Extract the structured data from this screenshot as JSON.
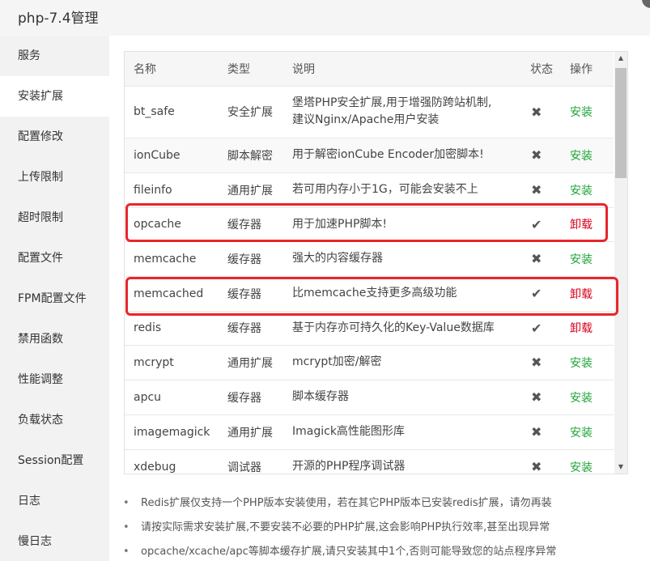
{
  "window": {
    "title": "php-7.4管理"
  },
  "sidebar": {
    "items": [
      {
        "label": "服务"
      },
      {
        "label": "安装扩展"
      },
      {
        "label": "配置修改"
      },
      {
        "label": "上传限制"
      },
      {
        "label": "超时限制"
      },
      {
        "label": "配置文件"
      },
      {
        "label": "FPM配置文件"
      },
      {
        "label": "禁用函数"
      },
      {
        "label": "性能调整"
      },
      {
        "label": "负载状态"
      },
      {
        "label": "Session配置"
      },
      {
        "label": "日志"
      },
      {
        "label": "慢日志"
      }
    ],
    "active_index": 1
  },
  "table": {
    "headers": {
      "name": "名称",
      "type": "类型",
      "desc": "说明",
      "status": "状态",
      "action": "操作"
    },
    "rows": [
      {
        "name": "bt_safe",
        "type": "安全扩展",
        "desc": "堡塔PHP安全扩展,用于增强防跨站机制,",
        "desc2": "建议Nginx/Apache用户安装",
        "status_icon": "✖",
        "installed": false,
        "action": "安装"
      },
      {
        "name": "ionCube",
        "type": "脚本解密",
        "desc": "用于解密ionCube Encoder加密脚本!",
        "status_icon": "✖",
        "installed": false,
        "action": "安装"
      },
      {
        "name": "fileinfo",
        "type": "通用扩展",
        "desc": "若可用内存小于1G，可能会安装不上",
        "status_icon": "✖",
        "installed": false,
        "action": "安装"
      },
      {
        "name": "opcache",
        "type": "缓存器",
        "desc": "用于加速PHP脚本!",
        "status_icon": "✔",
        "installed": true,
        "action": "卸载"
      },
      {
        "name": "memcache",
        "type": "缓存器",
        "desc": "强大的内容缓存器",
        "status_icon": "✖",
        "installed": false,
        "action": "安装"
      },
      {
        "name": "memcached",
        "type": "缓存器",
        "desc": "比memcache支持更多高级功能",
        "status_icon": "✔",
        "installed": true,
        "action": "卸载"
      },
      {
        "name": "redis",
        "type": "缓存器",
        "desc": "基于内存亦可持久化的Key-Value数据库",
        "status_icon": "✔",
        "installed": true,
        "action": "卸载"
      },
      {
        "name": "mcrypt",
        "type": "通用扩展",
        "desc": "mcrypt加密/解密",
        "status_icon": "✖",
        "installed": false,
        "action": "安装"
      },
      {
        "name": "apcu",
        "type": "缓存器",
        "desc": "脚本缓存器",
        "status_icon": "✖",
        "installed": false,
        "action": "安装"
      },
      {
        "name": "imagemagick",
        "type": "通用扩展",
        "desc": "Imagick高性能图形库",
        "status_icon": "✖",
        "installed": false,
        "action": "安装"
      },
      {
        "name": "xdebug",
        "type": "调试器",
        "desc": "开源的PHP程序调试器",
        "status_icon": "✖",
        "installed": false,
        "action": "安装"
      }
    ]
  },
  "notes": [
    "Redis扩展仅支持一个PHP版本安装使用，若在其它PHP版本已安装redis扩展，请勿再装",
    "请按实际需求安装扩展,不要安装不必要的PHP扩展,这会影响PHP执行效率,甚至出现异常",
    "opcache/xcache/apc等脚本缓存扩展,请只安装其中1个,否则可能导致您的站点程序异常"
  ],
  "colors": {
    "install": "#20a53a",
    "uninstall": "#d9001b",
    "highlight": "#e8262b"
  }
}
